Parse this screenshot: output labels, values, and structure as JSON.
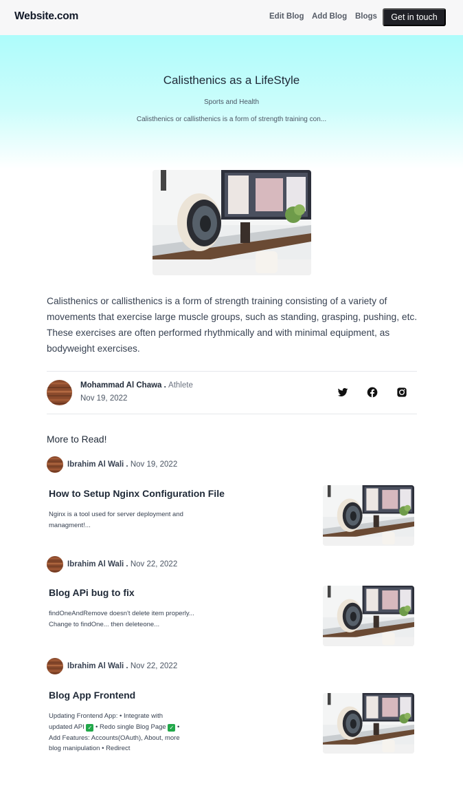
{
  "header": {
    "brand": "Website.com",
    "nav": [
      "Edit Blog",
      "Add Blog",
      "Blogs"
    ],
    "cta": "Get in touch"
  },
  "hero": {
    "title": "Calisthenics as a LifeStyle",
    "category": "Sports and Health",
    "summary": "Calisthenics or callisthenics is a form of strength training con..."
  },
  "article": {
    "body": "Calisthenics or callisthenics is a form of strength training consisting of a variety of movements that exercise large muscle groups, such as standing, grasping, pushing, etc. These exercises are often performed rhythmically and with minimal equipment, as bodyweight exercises."
  },
  "author": {
    "name": "Mohammad Al Chawa",
    "separator": " . ",
    "role": "Athlete",
    "date": "Nov 19, 2022"
  },
  "social_icons": [
    "twitter-icon",
    "facebook-icon",
    "instagram-icon"
  ],
  "more": {
    "heading": "More to Read!",
    "posts": [
      {
        "author": "Ibrahim Al Wali",
        "separator": " . ",
        "date": "Nov 19, 2022",
        "title": "How to Setup Nginx Configuration File",
        "excerpt": "Nginx is a tool used for server deployment and managment!..."
      },
      {
        "author": "Ibrahim Al Wali",
        "separator": " . ",
        "date": "Nov 22, 2022",
        "title": "Blog APi bug to fix",
        "excerpt": "findOneAndRemove doesn't delete item properly... Change to findOne... then deleteone..."
      },
      {
        "author": "Ibrahim Al Wali",
        "separator": " . ",
        "date": "Nov 22, 2022",
        "title": "Blog App Frontend",
        "excerpt_parts": [
          "Updating Frontend App: • Integrate with updated API ",
          " • Redo single Blog Page ",
          " • Add Features: Accounts(OAuth), About, more blog manipulation • Redirect"
        ]
      }
    ]
  },
  "colors": {
    "hero_top": "#aefcfb",
    "cta_bg": "#1f2026",
    "check_green": "#22a84a"
  }
}
